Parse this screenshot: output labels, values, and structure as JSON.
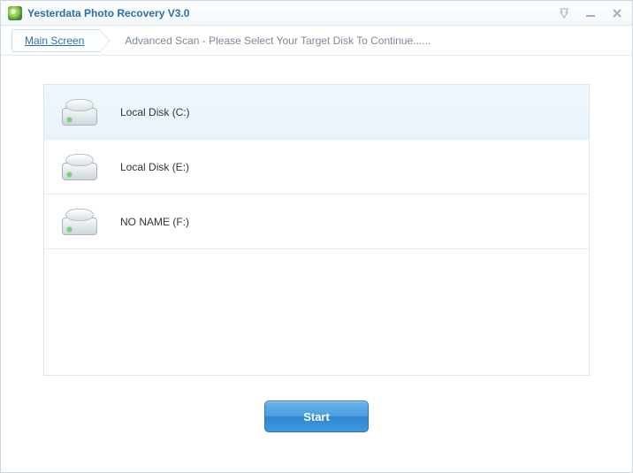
{
  "titlebar": {
    "app_title": "Yesterdata Photo Recovery V3.0"
  },
  "breadcrumb": {
    "main_label": "Main Screen",
    "description": "Advanced Scan - Please Select Your Target Disk To Continue......"
  },
  "disks": [
    {
      "label": "Local Disk (C:)",
      "selected": true
    },
    {
      "label": "Local Disk (E:)",
      "selected": false
    },
    {
      "label": "NO NAME (F:)",
      "selected": false
    }
  ],
  "footer": {
    "start_label": "Start"
  }
}
